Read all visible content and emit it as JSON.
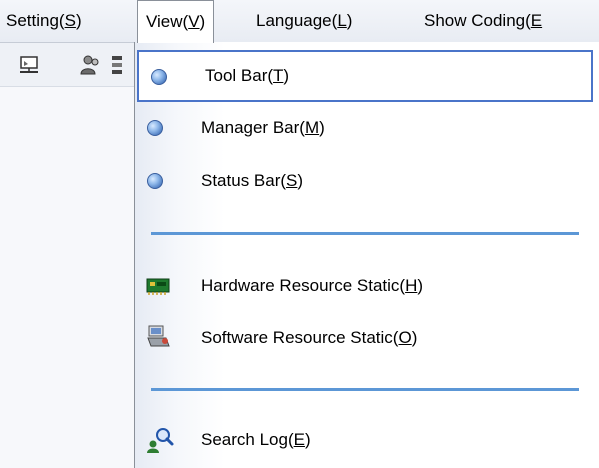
{
  "menubar": {
    "setting": {
      "text": "Setting(",
      "mnemonic": "S",
      "end": ")"
    },
    "view": {
      "text": "View(",
      "mnemonic": "V",
      "end": ")"
    },
    "language": {
      "text": "Language(",
      "mnemonic": "L",
      "end": ")"
    },
    "show_coding": {
      "text": "Show Coding(",
      "mnemonic": "E",
      "end": ""
    }
  },
  "view_menu": {
    "tool_bar": {
      "text": "Tool Bar(",
      "mnemonic": "T",
      "end": ")"
    },
    "manager_bar": {
      "text": "Manager Bar(",
      "mnemonic": "M",
      "end": ")"
    },
    "status_bar": {
      "text": "Status Bar(",
      "mnemonic": "S",
      "end": ")"
    },
    "hardware": {
      "text": "Hardware Resource Static(",
      "mnemonic": "H",
      "end": ")"
    },
    "software": {
      "text": "Software Resource Static(",
      "mnemonic": "O",
      "end": ")"
    },
    "search_log": {
      "text": "Search Log(",
      "mnemonic": "E",
      "end": ")"
    }
  },
  "colors": {
    "selection_border": "#4a74c9",
    "separator": "#5c97d6"
  }
}
